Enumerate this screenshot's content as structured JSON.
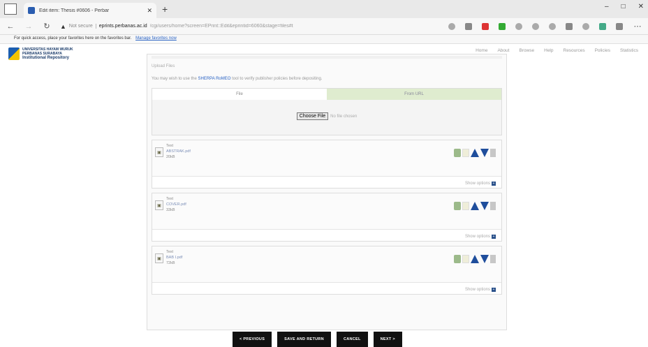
{
  "browser": {
    "tab_title": "Edit item: Thesis #0606 - Perbar",
    "new_tab": "+",
    "window_controls": [
      "–",
      "□",
      "✕"
    ],
    "not_secure": "Not secure",
    "domain": "eprints.perbanas.ac.id",
    "path": "/cgi/users/home?screen=EPrint::Edit&eprintid=6060&stage=files#t",
    "favorites_text": "For quick access, place your favorites here on the favorites bar.",
    "favorites_link": "Manage favorites now"
  },
  "site": {
    "logo_line1": "UNIVERSITAS HAYAM WURUK",
    "logo_line2": "PERBANAS SURABAYA",
    "logo_line3": "Institutional Repository",
    "nav": [
      "Home",
      "About",
      "Browse",
      "Help",
      "Resources",
      "Policies",
      "Statistics"
    ]
  },
  "upload": {
    "section_title": "Upload Files",
    "help_prefix": "You may wish to use the",
    "help_link": "SHERPA RoMEO",
    "help_suffix": "tool to verify publisher policies before depositing.",
    "tab_file": "File",
    "tab_url": "From URL",
    "choose_label": "Choose File",
    "no_file": "No file chosen"
  },
  "documents": [
    {
      "type": "Text",
      "filename": "ABSTRAK.pdf",
      "size": "20kB"
    },
    {
      "type": "Text",
      "filename": "COVER.pdf",
      "size": "33kB"
    },
    {
      "type": "Text",
      "filename": "BAB I.pdf",
      "size": "72kB"
    }
  ],
  "show_options": "Show options",
  "buttons": {
    "previous": "< PREVIOUS",
    "save_return": "SAVE AND RETURN",
    "cancel": "CANCEL",
    "next": "NEXT >"
  }
}
